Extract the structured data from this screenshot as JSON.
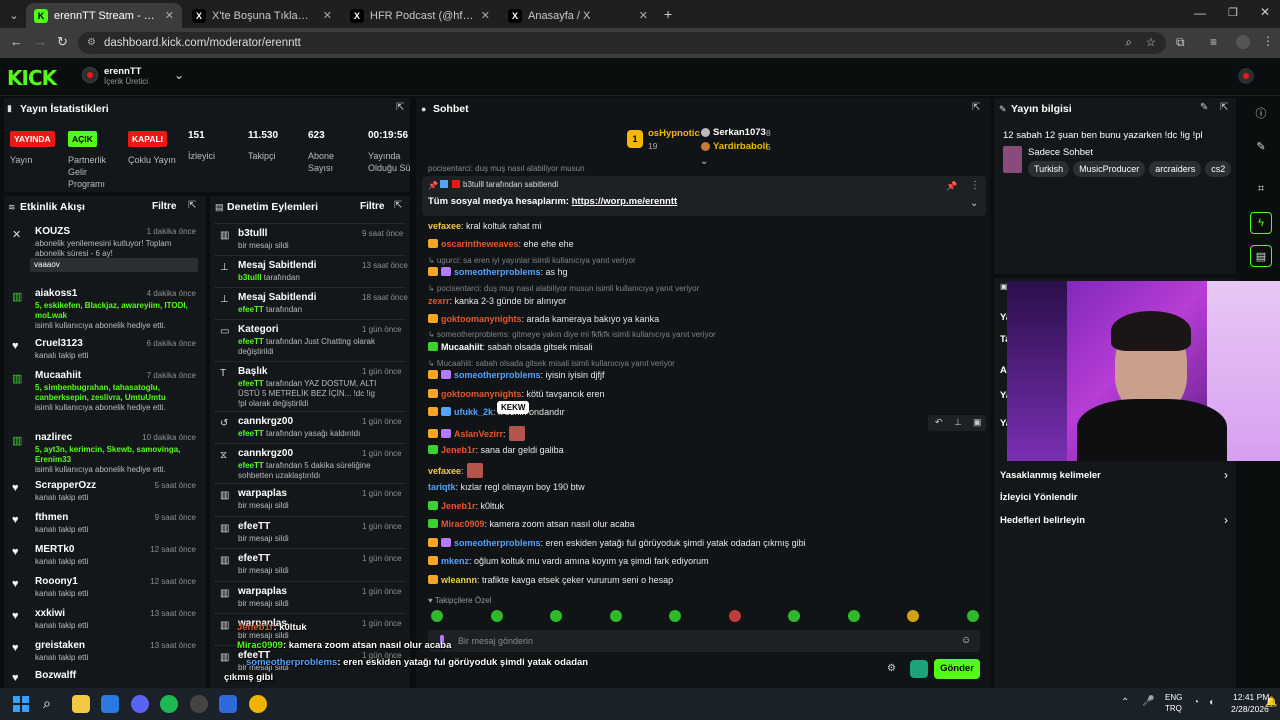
{
  "browser": {
    "tabs": [
      {
        "title": "erennTT Stream - Kick Dashbo",
        "active": true,
        "fav": "K"
      },
      {
        "title": "X'te Boşuna Tıklama: \"İran'ın ba",
        "active": false,
        "fav": "X"
      },
      {
        "title": "HFR Podcast (@hfrpodcast) / X",
        "active": false,
        "fav": "X"
      },
      {
        "title": "Anasayfa / X",
        "active": false,
        "fav": "X"
      }
    ],
    "url": "dashboard.kick.com/moderator/erenntt"
  },
  "header": {
    "logo": "KICK",
    "channel_name": "erennTT",
    "channel_role": "İçerik Üretici"
  },
  "stats": {
    "title": "Yayın İstatistikleri",
    "items": [
      {
        "badge": "YAYINDA",
        "label": "Yayın",
        "badge_color": "#e91916"
      },
      {
        "badge": "AÇIK",
        "label": "Partnerlik Gelir Programı",
        "badge_color": "#53fc18"
      },
      {
        "badge": "KAPALI",
        "label": "Çoklu Yayın",
        "badge_color": "#e91916"
      },
      {
        "value": "151",
        "label": "İzleyici"
      },
      {
        "value": "11.530",
        "label": "Takipçi"
      },
      {
        "value": "623",
        "label": "Abone Sayısı"
      },
      {
        "value": "00:19:56",
        "label": "Yayında Olduğu Süre"
      }
    ]
  },
  "activity": {
    "title": "Etkinlik Akışı",
    "filter": "Filtre",
    "items": [
      {
        "name": "KOUZS",
        "time": "1 dakika önce",
        "sub": "abonelik yenilemesini kutluyor! Toplam abonelik süresi - 6 ay!",
        "msg": "vaaaov",
        "icon": "gift"
      },
      {
        "name": "aiakoss1",
        "time": "4 dakika önce",
        "sub_green": "5, eskikefen, Blackjaz, awareyiim, ITODI, moLwak",
        "sub": "isimli kullanıcıya abonelik hediye etti.",
        "icon": "sub"
      },
      {
        "name": "Cruel3123",
        "time": "6 dakika önce",
        "sub": "kanalı takip etti",
        "icon": "heart"
      },
      {
        "name": "Mucaahiit",
        "time": "7 dakika önce",
        "sub_green": "5, simbenbugrahan, tahasatoglu, canberksepin, zeslivra, UmtuUmtu",
        "sub": "isimli kullanıcıya abonelik hediye etti.",
        "icon": "sub"
      },
      {
        "name": "nazlirec",
        "time": "10 dakika önce",
        "sub_green": "5, ayt3n, kerimcin, Skewb, samovinga, Erenim33",
        "sub": "isimli kullanıcıya abonelik hediye etti.",
        "icon": "sub"
      },
      {
        "name": "ScrapperOzz",
        "time": "5 saat önce",
        "sub": "kanalı takip etti",
        "icon": "heart"
      },
      {
        "name": "fthmen",
        "time": "9 saat önce",
        "sub": "kanalı takip etti",
        "icon": "heart"
      },
      {
        "name": "MERTk0",
        "time": "12 saat önce",
        "sub": "kanalı takip etti",
        "icon": "heart"
      },
      {
        "name": "Rooony1",
        "time": "12 saat önce",
        "sub": "kanalı takip etti",
        "icon": "heart"
      },
      {
        "name": "xxkiwi",
        "time": "13 saat önce",
        "sub": "kanalı takip etti",
        "icon": "heart"
      },
      {
        "name": "greistaken",
        "time": "13 saat önce",
        "sub": "kanalı takip etti",
        "icon": "heart"
      },
      {
        "name": "Bozwalff",
        "time": "",
        "sub": "",
        "icon": "heart"
      }
    ]
  },
  "mod": {
    "title": "Denetim Eylemleri",
    "filter": "Filtre",
    "items": [
      {
        "name": "b3tulll",
        "time": "9 saat önce",
        "sub": "bir mesajı sildi",
        "icon": "trash"
      },
      {
        "name": "Mesaj Sabitlendi",
        "time": "13 saat önce",
        "sub_green": "b3tulll",
        "sub": "tarafından",
        "icon": "pin"
      },
      {
        "name": "Mesaj Sabitlendi",
        "time": "18 saat önce",
        "sub_green": "efeeTT",
        "sub": "tarafından",
        "icon": "pin"
      },
      {
        "name": "Kategori",
        "time": "1 gün önce",
        "sub_green": "efeeTT",
        "sub": "tarafından Just Chatting olarak değiştirildi",
        "icon": "tag"
      },
      {
        "name": "Başlık",
        "time": "1 gün önce",
        "sub_green": "efeeTT",
        "sub": "tarafından YAZ DOSTUM, ALTI ÜSTÜ 5 METRELİK BEZ İÇİN... !dc !ig !pl olarak değiştirildi",
        "icon": "title"
      },
      {
        "name": "cannkrgz00",
        "time": "1 gün önce",
        "sub_green": "efeeTT",
        "sub": "tarafından yasağı kaldırıldı",
        "icon": "undo"
      },
      {
        "name": "cannkrgz00",
        "time": "1 gün önce",
        "sub_green": "efeeTT",
        "sub": "tarafından 5 dakika süreliğine sohbetten uzaklaştırıldı",
        "icon": "timer"
      },
      {
        "name": "warpaplas",
        "time": "1 gün önce",
        "sub": "bir mesajı sildi",
        "icon": "trash"
      },
      {
        "name": "efeeTT",
        "time": "1 gün önce",
        "sub": "bir mesajı sildi",
        "icon": "trash"
      },
      {
        "name": "efeeTT",
        "time": "1 gün önce",
        "sub": "bir mesajı sildi",
        "icon": "trash"
      },
      {
        "name": "warpaplas",
        "time": "1 gün önce",
        "sub": "bir mesajı sildi",
        "icon": "trash"
      },
      {
        "name": "warpaplas",
        "time": "1 gün önce",
        "sub": "bir mesajı sildi",
        "icon": "trash"
      },
      {
        "name": "efeeTT",
        "time": "1 gün önce",
        "sub": "bir mesajı sildi",
        "icon": "trash"
      }
    ]
  },
  "chat": {
    "title": "Sohbet",
    "top_gifters": [
      {
        "name": "osHypnotic",
        "count": "19"
      },
      {
        "name": "Serkan1073",
        "count": "8"
      },
      {
        "name": "Yardirbaboli",
        "count": "5"
      }
    ],
    "first_line": "pocisentarci: duş muş nasıl alabiliyor musun",
    "pinned_by": "b3tulll tarafından sabitlendi",
    "pinned_text": "Tüm sosyal medya hesaplarım: ",
    "pinned_link": "https://worp.me/erenntt",
    "messages": [
      {
        "type": "msg",
        "user": "vefaxee",
        "color": "#f2c94c",
        "text": ": kral koltuk rahat mi",
        "badge": ""
      },
      {
        "type": "msg",
        "user": "oscarintheweaves",
        "color": "#e4572e",
        "text": ": ehe ehe ehe",
        "badge": "#f5a623"
      },
      {
        "type": "reply",
        "text": "↳ ugurci: sa eren iyi yayınlar isimli kullanıcıya yanıt veriyor"
      },
      {
        "type": "msg",
        "user": "someotherproblems",
        "color": "#53a3ff",
        "text": ": as hg",
        "badge": "#f5a623",
        "badge2": "#b57bff"
      },
      {
        "type": "reply",
        "text": "↳ pocisentarci: duş muş nasıl alabiliyor musun isimli kullanıcıya yanıt veriyor"
      },
      {
        "type": "msg",
        "user": "zexrr",
        "color": "#e4572e",
        "text": ": kanka 2-3 günde bir alınıyor",
        "badge": ""
      },
      {
        "type": "msg",
        "user": "goktoomanynights",
        "color": "#e4572e",
        "text": ": arada kameraya bakıyo ya kanka",
        "badge": "#f5a623"
      },
      {
        "type": "reply",
        "text": "↳ someotherproblems: gitmeye yakın diye mi fkfkfk isimli kullanıcıya yanıt veriyor"
      },
      {
        "type": "msg",
        "user": "Mucaahiit",
        "color": "#ffffff",
        "text": ": sabah olsada gitsek misali",
        "badge": "#3bd12e"
      },
      {
        "type": "reply",
        "text": "↳ Mucaahiit: sabah olsada gitsek misali isimli kullanıcıya yanıt veriyor"
      },
      {
        "type": "msg",
        "user": "someotherproblems",
        "color": "#53a3ff",
        "text": ": iyisin iyisin djfjf",
        "badge": "#f5a623",
        "badge2": "#b57bff"
      },
      {
        "type": "msg",
        "user": "goktoomanynights",
        "color": "#e4572e",
        "text": ": kötü tavşancık eren",
        "badge": "#f5a623"
      },
      {
        "type": "msg",
        "user": "ufukk_2k",
        "color": "#53a3ff",
        "text": ": k senin ondandır",
        "badge": "#f5a623",
        "badge2": "#53a3ff"
      },
      {
        "type": "msg",
        "user": "AslanVezirr",
        "color": "#e4572e",
        "text": ":",
        "badge": "#f5a623",
        "badge2": "#b57bff",
        "emote": true
      },
      {
        "type": "msg",
        "user": "Jeneb1r",
        "color": "#e4572e",
        "text": ": sana dar geldi galiba",
        "badge": "#3bd12e"
      },
      {
        "type": "msg",
        "user": "vefaxee",
        "color": "#f2c94c",
        "text": ":",
        "badge": "",
        "emote": true
      },
      {
        "type": "msg",
        "user": "tariqtk",
        "color": "#53a3ff",
        "text": ": kızlar regl olmayın boy 190 btw",
        "badge": ""
      },
      {
        "type": "msg",
        "user": "Jeneb1r",
        "color": "#e4572e",
        "text": ": k0ltuk",
        "badge": "#3bd12e"
      },
      {
        "type": "msg",
        "user": "Mirac0909",
        "color": "#e4572e",
        "text": ": kamera zoom atsan nasıl olur acaba",
        "badge": "#3bd12e"
      },
      {
        "type": "msg",
        "user": "someotherproblems",
        "color": "#53a3ff",
        "text": ": eren eskiden yatağı ful görüyoduk şimdi yatak odadan çıkmış gibi",
        "badge": "#f5a623",
        "badge2": "#b57bff"
      },
      {
        "type": "msg",
        "user": "mkenz",
        "color": "#53a3ff",
        "text": ": oğlum koltuk mu vardı amına koyım ya şimdi fark ediyorum",
        "badge": "#f5a623"
      },
      {
        "type": "msg",
        "user": "wleannn",
        "color": "#f2c94c",
        "text": ": trafikte kavga etsek çeker vururum seni o hesap",
        "badge": "#f5a623"
      }
    ],
    "tooltip": "KEKW",
    "followers_only": "♥ Takipçilere Özel",
    "input_placeholder": "Bir mesaj gönderin",
    "send_label": "Gönder"
  },
  "info": {
    "title": "Yayın bilgisi",
    "stream_title": "12 sabah 12 şuan ben bunu yazarken !dc !ig !pl",
    "category": "Sadece Sohbet",
    "tags": [
      "Turkish",
      "MusicProducer",
      "arcraiders",
      "cs2"
    ],
    "links": [
      {
        "label": "Yasaklanmış kelimeler",
        "arrow": true
      },
      {
        "label": "İzleyici Yönlendir",
        "arrow": false
      },
      {
        "label": "Hedefleri belirleyin",
        "arrow": true
      }
    ],
    "partial_labels": [
      "Ya",
      "Ta",
      "Al",
      "Ya",
      "Ya"
    ]
  },
  "overlay": {
    "lines": [
      {
        "user": "Jeneb1r",
        "color": "#e4572e",
        "text": ": k0ltuk"
      },
      {
        "user": "Mirac0909",
        "color": "#53fc18",
        "text": ": kamera zoom atsan nasıl olur acaba"
      },
      {
        "user": "someotherproblems",
        "color": "#53a3ff",
        "text": ": eren eskiden yatağı ful görüyoduk şimdi yatak odadan"
      },
      {
        "user": "",
        "color": "#ffffff",
        "text": "çıkmış gibi"
      },
      {
        "user": "mkenz",
        "color": "#53a3ff",
        "text": ": oğlum koltuk mu vardı amına koyım ya şimdi fark ediyorum"
      },
      {
        "user": "wleannn",
        "color": "#f2c94c",
        "text": ": trafikte kavga etsek çeker vururum seni o hesap"
      }
    ]
  },
  "taskbar": {
    "lang1": "ENG",
    "lang2": "TRQ",
    "time": "12:41 PM",
    "date": "2/28/2026"
  }
}
